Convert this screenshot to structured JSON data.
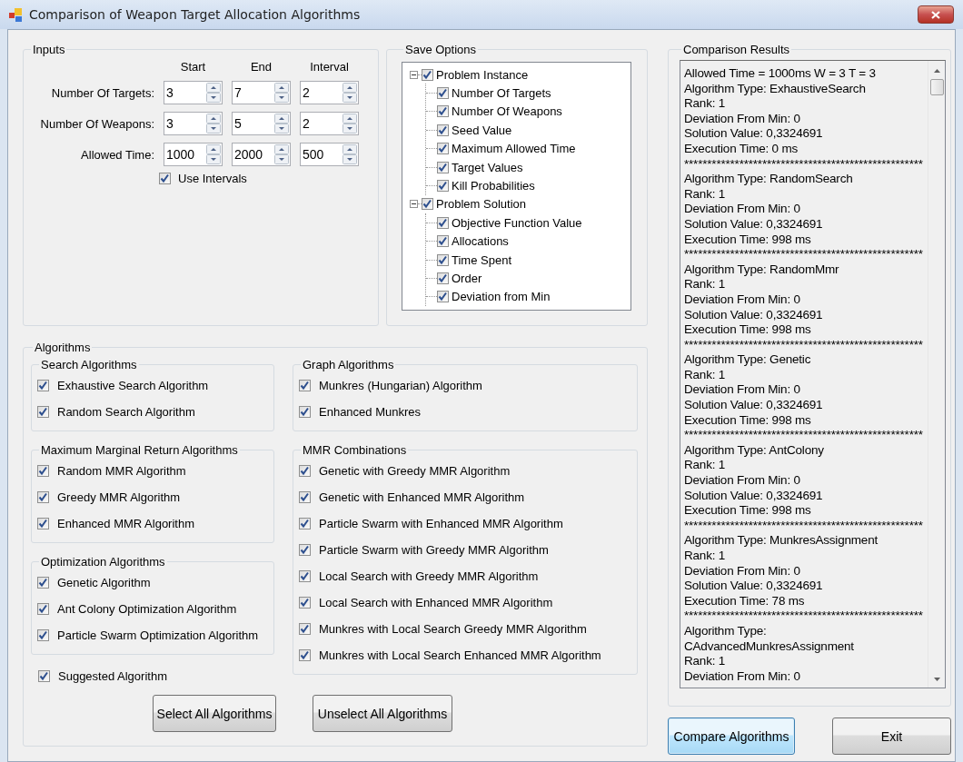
{
  "window": {
    "title": "Comparison of Weapon Target Allocation Algorithms"
  },
  "inputs": {
    "title": "Inputs",
    "columns": [
      "Start",
      "End",
      "Interval"
    ],
    "rows": [
      {
        "label": "Number Of Targets:",
        "values": [
          "3",
          "7",
          "2"
        ]
      },
      {
        "label": "Number Of Weapons:",
        "values": [
          "3",
          "5",
          "2"
        ]
      },
      {
        "label": "Allowed Time:",
        "values": [
          "1000",
          "2000",
          "500"
        ]
      }
    ],
    "use_intervals": {
      "label": "Use Intervals",
      "checked": true
    }
  },
  "save_options": {
    "title": "Save Options",
    "tree": [
      {
        "label": "Problem Instance",
        "checked": true,
        "expanded": true,
        "children": [
          {
            "label": "Number Of Targets",
            "checked": true
          },
          {
            "label": "Number Of Weapons",
            "checked": true
          },
          {
            "label": "Seed Value",
            "checked": true
          },
          {
            "label": "Maximum Allowed Time",
            "checked": true
          },
          {
            "label": "Target Values",
            "checked": true
          },
          {
            "label": "Kill Probabilities",
            "checked": true
          }
        ]
      },
      {
        "label": "Problem Solution",
        "checked": true,
        "expanded": true,
        "children": [
          {
            "label": "Objective Function Value",
            "checked": true
          },
          {
            "label": "Allocations",
            "checked": true
          },
          {
            "label": "Time Spent",
            "checked": true
          },
          {
            "label": "Order",
            "checked": true
          },
          {
            "label": "Deviation from Min",
            "checked": true
          }
        ]
      }
    ]
  },
  "algorithms": {
    "title": "Algorithms",
    "columns": [
      {
        "groups": [
          {
            "title": "Search Algorithms",
            "items": [
              {
                "label": "Exhaustive Search Algorithm",
                "checked": true
              },
              {
                "label": "Random Search Algorithm",
                "checked": true
              }
            ]
          },
          {
            "title": "Maximum Marginal Return Algorithms",
            "items": [
              {
                "label": "Random MMR Algorithm",
                "checked": true
              },
              {
                "label": "Greedy MMR Algorithm",
                "checked": true
              },
              {
                "label": "Enhanced MMR Algorithm",
                "checked": true
              }
            ]
          },
          {
            "title": "Optimization Algorithms",
            "items": [
              {
                "label": "Genetic Algorithm",
                "checked": true
              },
              {
                "label": "Ant Colony Optimization Algorithm",
                "checked": true
              },
              {
                "label": "Particle Swarm Optimization Algorithm",
                "checked": true
              }
            ]
          }
        ],
        "items": [
          {
            "label": "Suggested Algorithm",
            "checked": true
          }
        ]
      },
      {
        "groups": [
          {
            "title": "Graph Algorithms",
            "items": [
              {
                "label": "Munkres (Hungarian) Algorithm",
                "checked": true
              },
              {
                "label": "Enhanced Munkres",
                "checked": true
              }
            ]
          },
          {
            "title": "MMR Combinations",
            "items": [
              {
                "label": "Genetic with Greedy MMR Algorithm",
                "checked": true
              },
              {
                "label": "Genetic with Enhanced MMR Algorithm",
                "checked": true
              },
              {
                "label": "Particle Swarm with Enhanced MMR Algorithm",
                "checked": true
              },
              {
                "label": "Particle Swarm with Greedy MMR Algorithm",
                "checked": true
              },
              {
                "label": "Local Search with Greedy MMR Algorithm",
                "checked": true
              },
              {
                "label": "Local Search with Enhanced MMR Algorithm",
                "checked": true
              },
              {
                "label": "Munkres with Local Search Greedy MMR Algorithm",
                "checked": true
              },
              {
                "label": "Munkres with Local Search Enhanced MMR Algorithm",
                "checked": true
              }
            ]
          }
        ]
      }
    ],
    "buttons": [
      {
        "label": "Select All Algorithms",
        "focused": false
      },
      {
        "label": "Unselect All Algorithms",
        "focused": false
      }
    ]
  },
  "results": {
    "title": "Comparison Results",
    "lines": [
      "Allowed Time = 1000ms W = 3 T = 3",
      "Algorithm Type: ExhaustiveSearch",
      "Rank: 1",
      "Deviation From Min: 0",
      "Solution Value: 0,3324691",
      "Execution Time: 0 ms",
      "****************************************************",
      "Algorithm Type: RandomSearch",
      "Rank: 1",
      "Deviation From Min: 0",
      "Solution Value: 0,3324691",
      "Execution Time: 998 ms",
      "****************************************************",
      "Algorithm Type: RandomMmr",
      "Rank: 1",
      "Deviation From Min: 0",
      "Solution Value: 0,3324691",
      "Execution Time: 998 ms",
      "****************************************************",
      "Algorithm Type: Genetic",
      "Rank: 1",
      "Deviation From Min: 0",
      "Solution Value: 0,3324691",
      "Execution Time: 998 ms",
      "****************************************************",
      "Algorithm Type: AntColony",
      "Rank: 1",
      "Deviation From Min: 0",
      "Solution Value: 0,3324691",
      "Execution Time: 998 ms",
      "****************************************************",
      "Algorithm Type: MunkresAssignment",
      "Rank: 1",
      "Deviation From Min: 0",
      "Solution Value: 0,3324691",
      "Execution Time: 78 ms",
      "****************************************************",
      "Algorithm Type:",
      "CAdvancedMunkresAssignment",
      "Rank: 1",
      "Deviation From Min: 0"
    ]
  },
  "buttons": [
    {
      "label": "Compare Algorithms",
      "focused": true
    },
    {
      "label": "Exit",
      "focused": false
    }
  ]
}
